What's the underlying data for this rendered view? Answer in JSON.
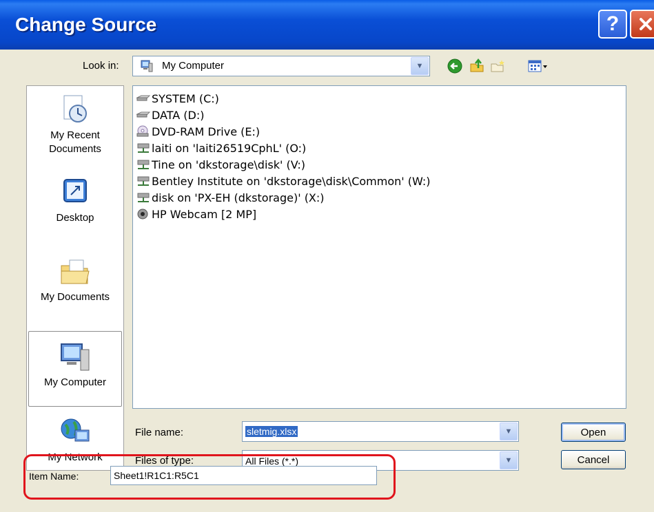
{
  "window": {
    "title": "Change Source"
  },
  "lookin": {
    "label": "Look in:",
    "value": "My Computer"
  },
  "places": [
    {
      "label": "My Recent Documents",
      "icon": "recent-documents-icon"
    },
    {
      "label": "Desktop",
      "icon": "desktop-icon"
    },
    {
      "label": "My Documents",
      "icon": "my-documents-icon"
    },
    {
      "label": "My Computer",
      "icon": "my-computer-icon",
      "selected": true
    },
    {
      "label": "My Network",
      "icon": "my-network-icon"
    }
  ],
  "files": [
    {
      "name": "SYSTEM (C:)",
      "icon": "hard-drive-icon"
    },
    {
      "name": "DATA (D:)",
      "icon": "hard-drive-icon"
    },
    {
      "name": "DVD-RAM Drive (E:)",
      "icon": "dvd-drive-icon"
    },
    {
      "name": "laiti on 'laiti26519CphL' (O:)",
      "icon": "network-drive-icon"
    },
    {
      "name": "Tine on 'dkstorage\\disk' (V:)",
      "icon": "network-drive-icon"
    },
    {
      "name": "Bentley Institute on 'dkstorage\\disk\\Common' (W:)",
      "icon": "network-drive-icon"
    },
    {
      "name": "disk on 'PX-EH (dkstorage)' (X:)",
      "icon": "network-drive-icon"
    },
    {
      "name": "HP Webcam [2 MP]",
      "icon": "webcam-icon"
    }
  ],
  "filename": {
    "label": "File name:",
    "value": "sletmig.xlsx"
  },
  "filetype": {
    "label": "Files of type:",
    "value": "All Files (*.*)"
  },
  "buttons": {
    "open": "Open",
    "cancel": "Cancel"
  },
  "item_name": {
    "label": "Item Name:",
    "value": "Sheet1!R1C1:R5C1"
  },
  "colors": {
    "titlebar": "#0a4fd6",
    "selection": "#316ac5",
    "highlight": "#e0141c"
  }
}
